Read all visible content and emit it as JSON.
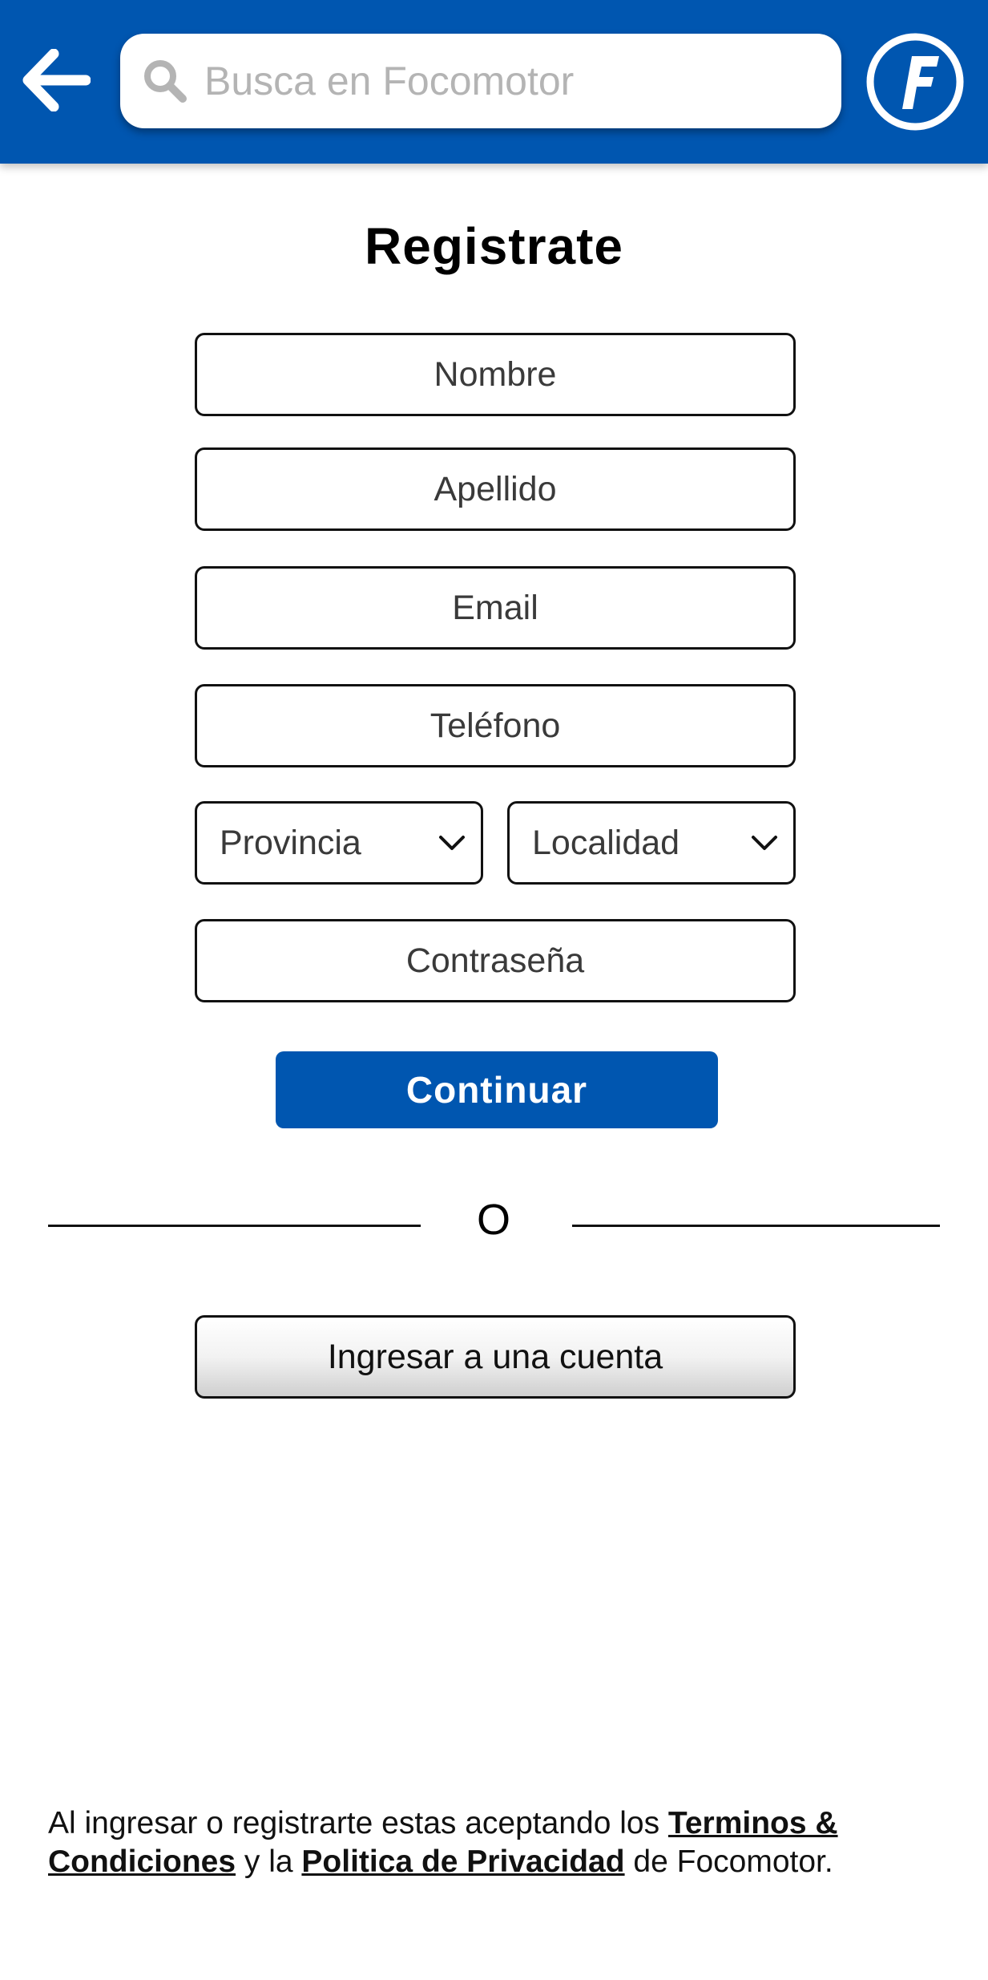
{
  "header": {
    "back_label": "back",
    "search": {
      "placeholder": "Busca en Focomotor",
      "value": ""
    },
    "logo_icon": "focomotor-logo",
    "brand_color": "#0056b0"
  },
  "form": {
    "title": "Registrate",
    "fields": {
      "nombre": "Nombre",
      "apellido": "Apellido",
      "email": "Email",
      "telefono": "Teléfono",
      "contrasena": "Contraseña"
    },
    "selects": {
      "provincia": "Provincia",
      "localidad": "Localidad"
    },
    "continue_label": "Continuar",
    "divider_text": "O",
    "login_label": "Ingresar a una cuenta"
  },
  "footer": {
    "text_before": "Al ingresar o registrarte estas aceptando los ",
    "terms_link": "Terminos & Condiciones",
    "text_middle": " y la ",
    "privacy_link": "Politica de Privacidad",
    "text_after": " de Focomotor."
  }
}
